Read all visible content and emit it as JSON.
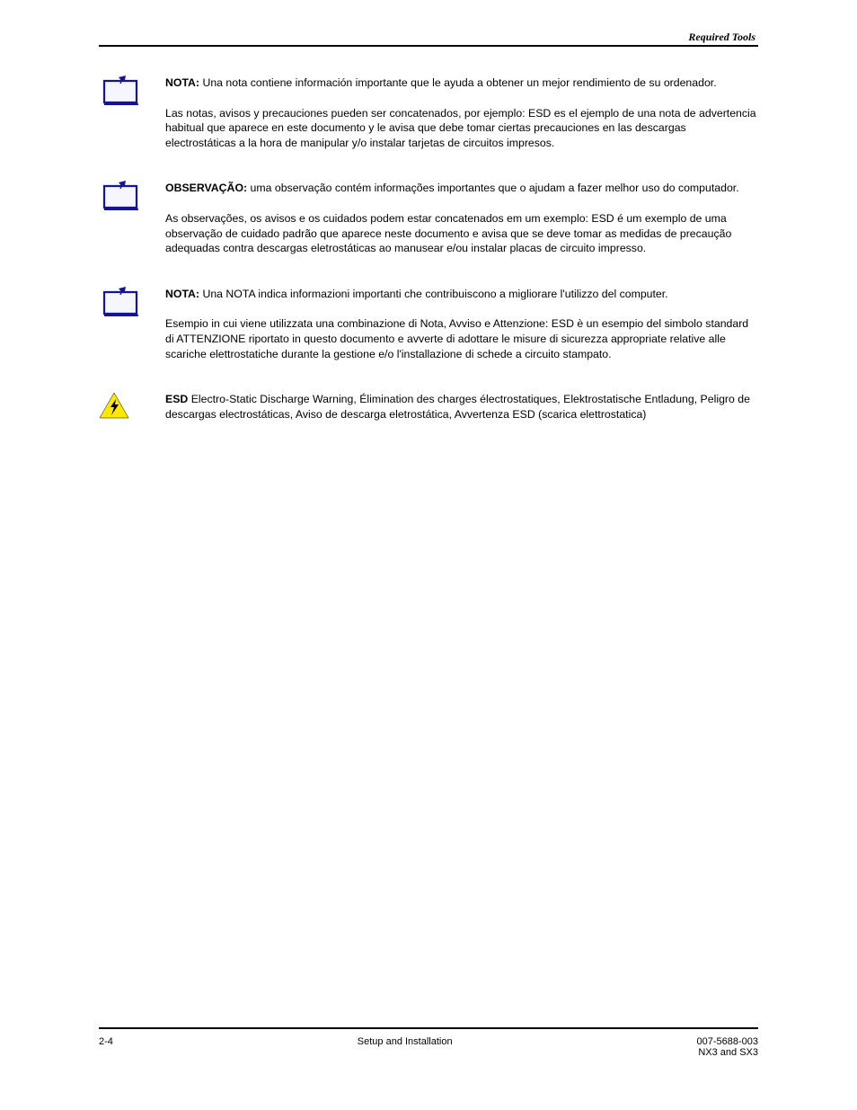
{
  "header": {
    "right": "Required Tools"
  },
  "blocks": [
    {
      "icon": "note",
      "label": "NOTA:",
      "para1": "Una nota contiene información importante que le ayuda a obtener un mejor rendimiento de su ordenador.",
      "para2": "Las notas, avisos y precauciones pueden ser concatenados, por ejemplo: ESD es el ejemplo de una nota de advertencia habitual que aparece en este documento y le avisa que debe tomar ciertas precauciones en las descargas electrostáticas a la hora de manipular y/o instalar tarjetas de circuitos impresos."
    },
    {
      "icon": "note",
      "label": "OBSERVAÇÃO:",
      "para1": "uma observação contém informações importantes que o ajudam a fazer melhor uso do computador.",
      "para2": "As observações, os avisos e os cuidados podem estar concatenados em um exemplo: ESD é um exemplo de uma observação de cuidado padrão que aparece neste documento e avisa que se deve tomar as medidas de precaução adequadas contra descargas eletrostáticas ao manusear e/ou instalar placas de circuito impresso."
    },
    {
      "icon": "note",
      "label": "NOTA:",
      "para1": "Una NOTA indica informazioni importanti che contribuiscono a migliorare l'utilizzo del computer.",
      "para2": "Esempio in cui viene utilizzata una combinazione di Nota, Avviso e Attenzione: ESD è un esempio del simbolo standard di ATTENZIONE riportato in questo documento e avverte di adottare le misure di sicurezza appropriate relative alle scariche elettrostatiche durante la gestione e/o l'installazione di schede a circuito stampato."
    },
    {
      "icon": "shock",
      "label": "ESD",
      "para1": "Electro-Static Discharge Warning, Élimination des charges électrostatiques, Elektrostatische Entladung, Peligro de descargas electrostáticas, Aviso de descarga eletrostática, Avvertenza ESD (scarica elettrostatica)",
      "para2": null
    }
  ],
  "footer": {
    "left": "2-4",
    "center": "Setup and Installation",
    "right_line1": "007-5688-003",
    "right_line2": "NX3 and SX3"
  }
}
